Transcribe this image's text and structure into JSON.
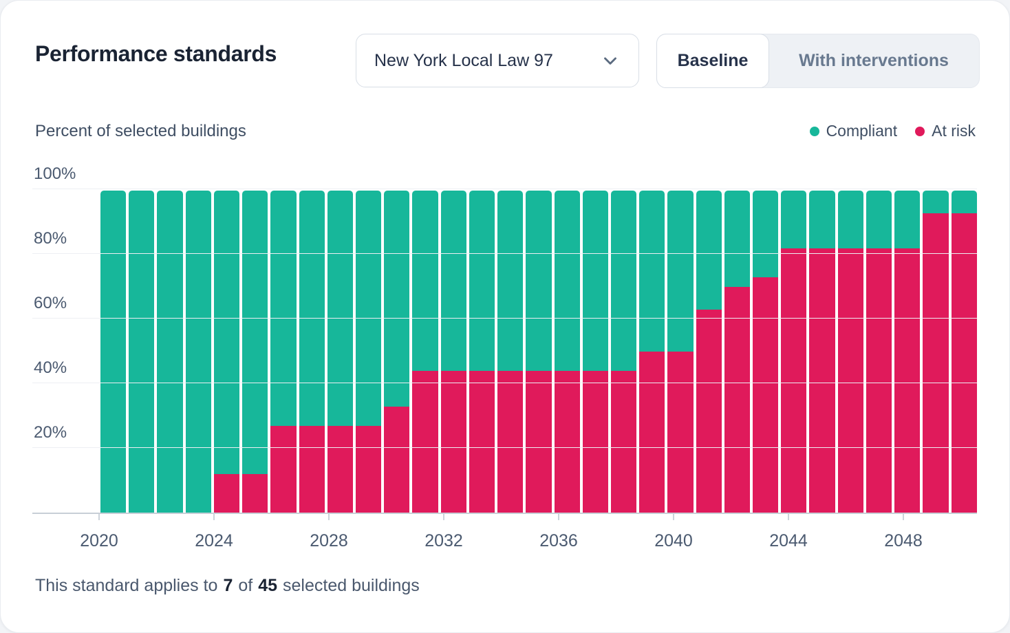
{
  "header": {
    "title": "Performance standards",
    "dropdown": {
      "value": "New York Local Law 97"
    },
    "toggle": {
      "options": [
        "Baseline",
        "With interventions"
      ],
      "selected": "Baseline"
    }
  },
  "legend": [
    {
      "label": "Compliant",
      "color": "#17b79a"
    },
    {
      "label": "At risk",
      "color": "#e01a5b"
    }
  ],
  "chart_data": {
    "type": "bar",
    "stacked": true,
    "axis_title": "Percent of selected buildings",
    "categories": [
      2020,
      2021,
      2022,
      2023,
      2024,
      2025,
      2026,
      2027,
      2028,
      2029,
      2030,
      2031,
      2032,
      2033,
      2034,
      2035,
      2036,
      2037,
      2038,
      2039,
      2040,
      2041,
      2042,
      2043,
      2044,
      2045,
      2046,
      2047,
      2048,
      2049,
      2050
    ],
    "series": [
      {
        "name": "Compliant",
        "color": "#17b79a",
        "values": [
          100,
          100,
          100,
          100,
          88,
          88,
          73,
          73,
          73,
          73,
          67,
          56,
          56,
          56,
          56,
          56,
          56,
          56,
          56,
          50,
          50,
          37,
          30,
          27,
          18,
          18,
          18,
          18,
          18,
          7,
          7
        ]
      },
      {
        "name": "At risk",
        "color": "#e01a5b",
        "values": [
          0,
          0,
          0,
          0,
          12,
          12,
          27,
          27,
          27,
          27,
          33,
          44,
          44,
          44,
          44,
          44,
          44,
          44,
          44,
          50,
          50,
          63,
          70,
          73,
          82,
          82,
          82,
          82,
          82,
          93,
          93
        ]
      }
    ],
    "x_tick_labels": [
      "2020",
      "2024",
      "2028",
      "2032",
      "2036",
      "2040",
      "2044",
      "2048"
    ],
    "y_tick_labels": [
      "20%",
      "40%",
      "60%",
      "80%",
      "100%"
    ],
    "ylim": [
      0,
      100
    ],
    "grid": true,
    "legend_position": "top-right"
  },
  "footer": {
    "prefix": "This standard applies to",
    "count": "7",
    "of": "of",
    "total": "45",
    "suffix": "selected buildings"
  }
}
